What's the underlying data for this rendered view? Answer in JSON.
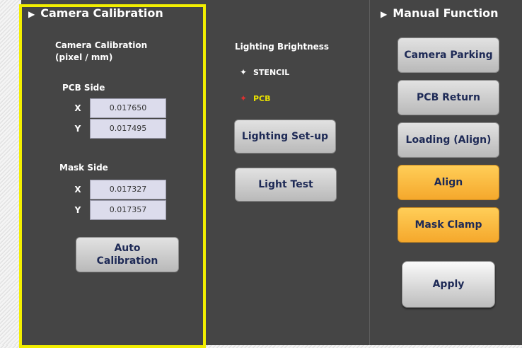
{
  "camera_calibration": {
    "header": "Camera Calibration",
    "subtitle_line1": "Camera Calibration",
    "subtitle_line2": "(pixel / mm)",
    "pcb_side": {
      "label": "PCB Side",
      "x_label": "X",
      "x_value": "0.017650",
      "y_label": "Y",
      "y_value": "0.017495"
    },
    "mask_side": {
      "label": "Mask Side",
      "x_label": "X",
      "x_value": "0.017327",
      "y_label": "Y",
      "y_value": "0.017357"
    },
    "auto_calibration_line1": "Auto",
    "auto_calibration_line2": "Calibration"
  },
  "lighting": {
    "title": "Lighting Brightness",
    "options": [
      {
        "label": "STENCIL",
        "icon": "white-star-icon",
        "color": "#ffffff"
      },
      {
        "label": "PCB",
        "icon": "red-star-icon",
        "color": "#e8e000"
      }
    ],
    "setup_button": "Lighting Set-up",
    "test_button": "Light Test"
  },
  "manual_function": {
    "header": "Manual Function",
    "buttons": [
      {
        "label": "Camera Parking",
        "style": "gray"
      },
      {
        "label": "PCB Return",
        "style": "gray"
      },
      {
        "label": "Loading (Align)",
        "style": "gray"
      },
      {
        "label": "Align",
        "style": "orange"
      },
      {
        "label": "Mask Clamp",
        "style": "orange"
      }
    ],
    "apply_button": "Apply"
  },
  "colors": {
    "panel_bg": "#454545",
    "highlight_frame": "#f2ee00",
    "button_text": "#1e2a56",
    "orange_button": "#f8b83c",
    "pcb_label": "#e8e000"
  }
}
